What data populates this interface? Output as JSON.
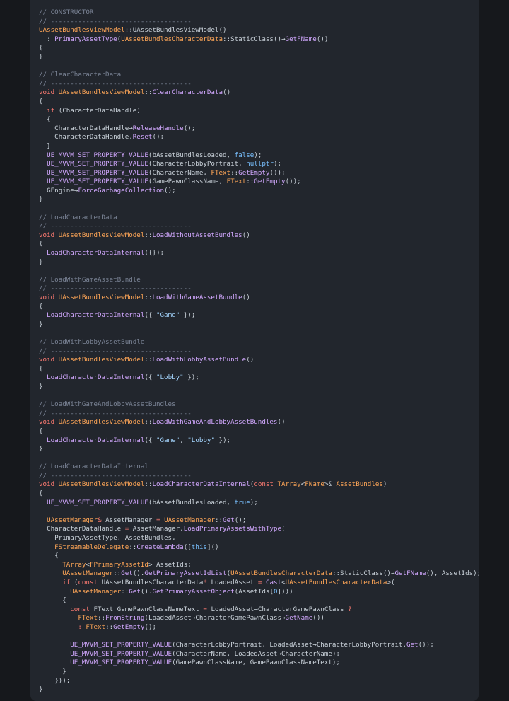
{
  "theme": {
    "background": "#16181c",
    "panel": "#22262d",
    "colors": {
      "plain": "#c9d1d9",
      "comment": "#7b8496",
      "keyword": "#ff7b72",
      "type": "#ffa657",
      "func": "#d2a8ff",
      "string": "#a5d6ff",
      "literal": "#79c0ff"
    }
  },
  "code": {
    "lines": [
      [
        [
          "comment",
          "// CONSTRUCTOR"
        ]
      ],
      [
        [
          "comment",
          "// ------------------------------------"
        ]
      ],
      [
        [
          "type",
          "UAssetBundlesViewModel"
        ],
        [
          "plain",
          "::UAssetBundlesViewModel()"
        ]
      ],
      [
        [
          "plain",
          "  : "
        ],
        [
          "func",
          "PrimaryAssetType"
        ],
        [
          "plain",
          "("
        ],
        [
          "type",
          "UAssetBundlesCharacterData"
        ],
        [
          "plain",
          "::StaticClass()→"
        ],
        [
          "func",
          "GetFName"
        ],
        [
          "plain",
          "())"
        ]
      ],
      [
        [
          "plain",
          "{"
        ]
      ],
      [
        [
          "plain",
          "}"
        ]
      ],
      [
        [
          "plain",
          ""
        ]
      ],
      [
        [
          "comment",
          "// ClearCharacterData"
        ]
      ],
      [
        [
          "comment",
          "// ------------------------------------"
        ]
      ],
      [
        [
          "keyword",
          "void "
        ],
        [
          "type",
          "UAssetBundlesViewModel"
        ],
        [
          "plain",
          "::"
        ],
        [
          "func",
          "ClearCharacterData"
        ],
        [
          "plain",
          "()"
        ]
      ],
      [
        [
          "plain",
          "{"
        ]
      ],
      [
        [
          "plain",
          "  "
        ],
        [
          "keyword",
          "if"
        ],
        [
          "plain",
          " (CharacterDataHandle)"
        ]
      ],
      [
        [
          "plain",
          "  {"
        ]
      ],
      [
        [
          "plain",
          "    CharacterDataHandle→"
        ],
        [
          "func",
          "ReleaseHandle"
        ],
        [
          "plain",
          "();"
        ]
      ],
      [
        [
          "plain",
          "    CharacterDataHandle."
        ],
        [
          "func",
          "Reset"
        ],
        [
          "plain",
          "();"
        ]
      ],
      [
        [
          "plain",
          "  }"
        ]
      ],
      [
        [
          "plain",
          "  "
        ],
        [
          "macro",
          "UE_MVVM_SET_PROPERTY_VALUE"
        ],
        [
          "plain",
          "(bAssetBundlesLoaded, "
        ],
        [
          "literal",
          "false"
        ],
        [
          "plain",
          ");"
        ]
      ],
      [
        [
          "plain",
          "  "
        ],
        [
          "macro",
          "UE_MVVM_SET_PROPERTY_VALUE"
        ],
        [
          "plain",
          "(CharacterLobbyPortrait, "
        ],
        [
          "literal",
          "nullptr"
        ],
        [
          "plain",
          ");"
        ]
      ],
      [
        [
          "plain",
          "  "
        ],
        [
          "macro",
          "UE_MVVM_SET_PROPERTY_VALUE"
        ],
        [
          "plain",
          "(CharacterName, "
        ],
        [
          "type",
          "FText"
        ],
        [
          "plain",
          "::"
        ],
        [
          "func",
          "GetEmpty"
        ],
        [
          "plain",
          "());"
        ]
      ],
      [
        [
          "plain",
          "  "
        ],
        [
          "macro",
          "UE_MVVM_SET_PROPERTY_VALUE"
        ],
        [
          "plain",
          "(GamePawnClassName, "
        ],
        [
          "type",
          "FText"
        ],
        [
          "plain",
          "::"
        ],
        [
          "func",
          "GetEmpty"
        ],
        [
          "plain",
          "());"
        ]
      ],
      [
        [
          "plain",
          "  GEngine→"
        ],
        [
          "func",
          "ForceGarbageCollection"
        ],
        [
          "plain",
          "();"
        ]
      ],
      [
        [
          "plain",
          "}"
        ]
      ],
      [
        [
          "plain",
          ""
        ]
      ],
      [
        [
          "comment",
          "// LoadCharacterData"
        ]
      ],
      [
        [
          "comment",
          "// ------------------------------------"
        ]
      ],
      [
        [
          "keyword",
          "void "
        ],
        [
          "type",
          "UAssetBundlesViewModel"
        ],
        [
          "plain",
          "::"
        ],
        [
          "func",
          "LoadWithoutAssetBundles"
        ],
        [
          "plain",
          "()"
        ]
      ],
      [
        [
          "plain",
          "{"
        ]
      ],
      [
        [
          "plain",
          "  "
        ],
        [
          "func",
          "LoadCharacterDataInternal"
        ],
        [
          "plain",
          "({});"
        ]
      ],
      [
        [
          "plain",
          "}"
        ]
      ],
      [
        [
          "plain",
          ""
        ]
      ],
      [
        [
          "comment",
          "// LoadWithGameAssetBundle"
        ]
      ],
      [
        [
          "comment",
          "// ------------------------------------"
        ]
      ],
      [
        [
          "keyword",
          "void "
        ],
        [
          "type",
          "UAssetBundlesViewModel"
        ],
        [
          "plain",
          "::"
        ],
        [
          "func",
          "LoadWithGameAssetBundle"
        ],
        [
          "plain",
          "()"
        ]
      ],
      [
        [
          "plain",
          "{"
        ]
      ],
      [
        [
          "plain",
          "  "
        ],
        [
          "func",
          "LoadCharacterDataInternal"
        ],
        [
          "plain",
          "({ "
        ],
        [
          "string",
          "\"Game\""
        ],
        [
          "plain",
          " });"
        ]
      ],
      [
        [
          "plain",
          "}"
        ]
      ],
      [
        [
          "plain",
          ""
        ]
      ],
      [
        [
          "comment",
          "// LoadWithLobbyAssetBundle"
        ]
      ],
      [
        [
          "comment",
          "// ------------------------------------"
        ]
      ],
      [
        [
          "keyword",
          "void "
        ],
        [
          "type",
          "UAssetBundlesViewModel"
        ],
        [
          "plain",
          "::"
        ],
        [
          "func",
          "LoadWithLobbyAssetBundle"
        ],
        [
          "plain",
          "()"
        ]
      ],
      [
        [
          "plain",
          "{"
        ]
      ],
      [
        [
          "plain",
          "  "
        ],
        [
          "func",
          "LoadCharacterDataInternal"
        ],
        [
          "plain",
          "({ "
        ],
        [
          "string",
          "\"Lobby\""
        ],
        [
          "plain",
          " });"
        ]
      ],
      [
        [
          "plain",
          "}"
        ]
      ],
      [
        [
          "plain",
          ""
        ]
      ],
      [
        [
          "comment",
          "// LoadWithGameAndLobbyAssetBundles"
        ]
      ],
      [
        [
          "comment",
          "// ------------------------------------"
        ]
      ],
      [
        [
          "keyword",
          "void "
        ],
        [
          "type",
          "UAssetBundlesViewModel"
        ],
        [
          "plain",
          "::"
        ],
        [
          "func",
          "LoadWithGameAndLobbyAssetBundles"
        ],
        [
          "plain",
          "()"
        ]
      ],
      [
        [
          "plain",
          "{"
        ]
      ],
      [
        [
          "plain",
          "  "
        ],
        [
          "func",
          "LoadCharacterDataInternal"
        ],
        [
          "plain",
          "({ "
        ],
        [
          "string",
          "\"Game\""
        ],
        [
          "plain",
          ", "
        ],
        [
          "string",
          "\"Lobby\""
        ],
        [
          "plain",
          " });"
        ]
      ],
      [
        [
          "plain",
          "}"
        ]
      ],
      [
        [
          "plain",
          ""
        ]
      ],
      [
        [
          "comment",
          "// LoadCharacterDataInternal"
        ]
      ],
      [
        [
          "comment",
          "// ------------------------------------"
        ]
      ],
      [
        [
          "keyword",
          "void "
        ],
        [
          "type",
          "UAssetBundlesViewModel"
        ],
        [
          "plain",
          "::"
        ],
        [
          "func",
          "LoadCharacterDataInternal"
        ],
        [
          "plain",
          "("
        ],
        [
          "keyword",
          "const "
        ],
        [
          "type",
          "TArray"
        ],
        [
          "plain",
          "<"
        ],
        [
          "type",
          "FName"
        ],
        [
          "plain",
          ">& "
        ],
        [
          "type",
          "AssetBundles"
        ],
        [
          "plain",
          ")"
        ]
      ],
      [
        [
          "plain",
          "{"
        ]
      ],
      [
        [
          "plain",
          "  "
        ],
        [
          "macro",
          "UE_MVVM_SET_PROPERTY_VALUE"
        ],
        [
          "plain",
          "(bAssetBundlesLoaded, "
        ],
        [
          "literal",
          "true"
        ],
        [
          "plain",
          ");"
        ]
      ],
      [
        [
          "plain",
          ""
        ]
      ],
      [
        [
          "plain",
          "  "
        ],
        [
          "type",
          "UAssetManager"
        ],
        [
          "keyword",
          "&"
        ],
        [
          "plain",
          " AssetManager "
        ],
        [
          "keyword",
          "="
        ],
        [
          "plain",
          " "
        ],
        [
          "type",
          "UAssetManager"
        ],
        [
          "plain",
          "::"
        ],
        [
          "func",
          "Get"
        ],
        [
          "plain",
          "();"
        ]
      ],
      [
        [
          "plain",
          "  CharacterDataHandle "
        ],
        [
          "keyword",
          "="
        ],
        [
          "plain",
          " AssetManager."
        ],
        [
          "func",
          "LoadPrimaryAssetsWithType"
        ],
        [
          "plain",
          "("
        ]
      ],
      [
        [
          "plain",
          "    PrimaryAssetType, AssetBundles,"
        ]
      ],
      [
        [
          "plain",
          "    "
        ],
        [
          "type",
          "FStreamableDelegate"
        ],
        [
          "plain",
          "::"
        ],
        [
          "func",
          "CreateLambda"
        ],
        [
          "plain",
          "(["
        ],
        [
          "literal",
          "this"
        ],
        [
          "plain",
          "]()"
        ]
      ],
      [
        [
          "plain",
          "    {"
        ]
      ],
      [
        [
          "plain",
          "      "
        ],
        [
          "type",
          "TArray"
        ],
        [
          "plain",
          "<"
        ],
        [
          "type",
          "FPrimaryAssetId"
        ],
        [
          "plain",
          "> AssetIds;"
        ]
      ],
      [
        [
          "plain",
          "      "
        ],
        [
          "type",
          "UAssetManager"
        ],
        [
          "plain",
          "::"
        ],
        [
          "func",
          "Get"
        ],
        [
          "plain",
          "()."
        ],
        [
          "func",
          "GetPrimaryAssetIdList"
        ],
        [
          "plain",
          "("
        ],
        [
          "type",
          "UAssetBundlesCharacterData"
        ],
        [
          "plain",
          "::StaticClass()→"
        ],
        [
          "func",
          "GetFName"
        ],
        [
          "plain",
          "(), AssetIds);"
        ]
      ],
      [
        [
          "plain",
          "      "
        ],
        [
          "keyword",
          "if"
        ],
        [
          "plain",
          " ("
        ],
        [
          "keyword",
          "const"
        ],
        [
          "plain",
          " UAssetBundlesCharacterData"
        ],
        [
          "keyword",
          "*"
        ],
        [
          "plain",
          " LoadedAsset "
        ],
        [
          "keyword",
          "="
        ],
        [
          "plain",
          " "
        ],
        [
          "func",
          "Cast"
        ],
        [
          "plain",
          "<"
        ],
        [
          "type",
          "UAssetBundlesCharacterData"
        ],
        [
          "plain",
          ">("
        ]
      ],
      [
        [
          "plain",
          "        "
        ],
        [
          "type",
          "UAssetManager"
        ],
        [
          "plain",
          "::"
        ],
        [
          "func",
          "Get"
        ],
        [
          "plain",
          "()."
        ],
        [
          "func",
          "GetPrimaryAssetObject"
        ],
        [
          "plain",
          "(AssetIds["
        ],
        [
          "literal",
          "0"
        ],
        [
          "plain",
          "])))"
        ]
      ],
      [
        [
          "plain",
          "      {"
        ]
      ],
      [
        [
          "plain",
          "        "
        ],
        [
          "keyword",
          "const"
        ],
        [
          "plain",
          " FText GamePawnClassNameText "
        ],
        [
          "keyword",
          "="
        ],
        [
          "plain",
          " LoadedAsset→CharacterGamePawnClass "
        ],
        [
          "keyword",
          "?"
        ]
      ],
      [
        [
          "plain",
          "          "
        ],
        [
          "type",
          "FText"
        ],
        [
          "plain",
          "::"
        ],
        [
          "func",
          "FromString"
        ],
        [
          "plain",
          "(LoadedAsset→CharacterGamePawnClass→"
        ],
        [
          "func",
          "GetName"
        ],
        [
          "plain",
          "())"
        ]
      ],
      [
        [
          "plain",
          "          "
        ],
        [
          "keyword",
          ": "
        ],
        [
          "type",
          "FText"
        ],
        [
          "plain",
          "::"
        ],
        [
          "func",
          "GetEmpty"
        ],
        [
          "plain",
          "();"
        ]
      ],
      [
        [
          "plain",
          ""
        ]
      ],
      [
        [
          "plain",
          "        "
        ],
        [
          "macro",
          "UE_MVVM_SET_PROPERTY_VALUE"
        ],
        [
          "plain",
          "(CharacterLobbyPortrait, LoadedAsset→CharacterLobbyPortrait."
        ],
        [
          "func",
          "Get"
        ],
        [
          "plain",
          "());"
        ]
      ],
      [
        [
          "plain",
          "        "
        ],
        [
          "macro",
          "UE_MVVM_SET_PROPERTY_VALUE"
        ],
        [
          "plain",
          "(CharacterName, LoadedAsset→CharacterName);"
        ]
      ],
      [
        [
          "plain",
          "        "
        ],
        [
          "macro",
          "UE_MVVM_SET_PROPERTY_VALUE"
        ],
        [
          "plain",
          "(GamePawnClassName, GamePawnClassNameText);"
        ]
      ],
      [
        [
          "plain",
          "      }"
        ]
      ],
      [
        [
          "plain",
          "    }));"
        ]
      ],
      [
        [
          "plain",
          "}"
        ]
      ]
    ]
  }
}
